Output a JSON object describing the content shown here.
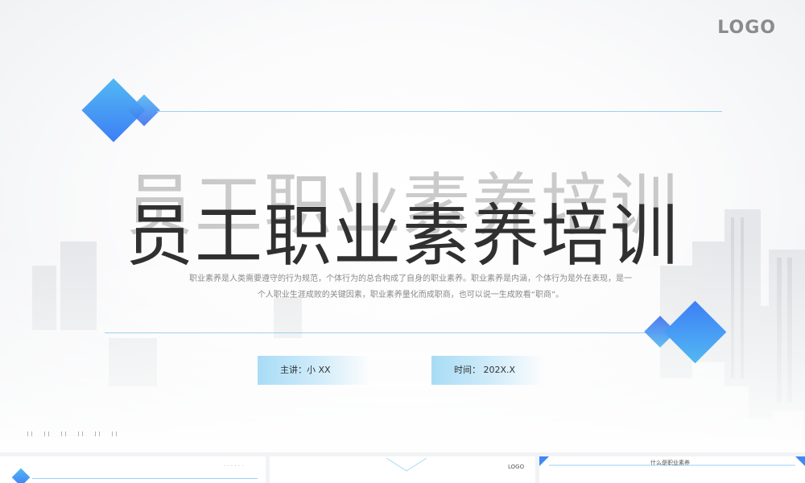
{
  "slide": {
    "logo": "LOGO",
    "title": "员工职业素养培训",
    "description_line1": "职业素养是人类需要遵守的行为规范，个体行为的总合构成了自身的职业素养。职业素养是内涵，个体行为是外在表现，是一",
    "description_line2": "个人职业生涯成败的关键因素，职业素养量化而成职商，也可以说一生成败看“职商”。",
    "speaker_label": "主讲：小 XX",
    "date_label": "时间：  202X.X",
    "colors": {
      "accent_blue": "#3d7ff6",
      "accent_cyan": "#52b8f2",
      "line": "#9ed0f3",
      "title": "#303030"
    }
  },
  "thumbnails": [
    {
      "dots": "· · · · · ·"
    },
    {
      "logo": "LOGO"
    },
    {
      "title": "什么是职业素养"
    }
  ]
}
